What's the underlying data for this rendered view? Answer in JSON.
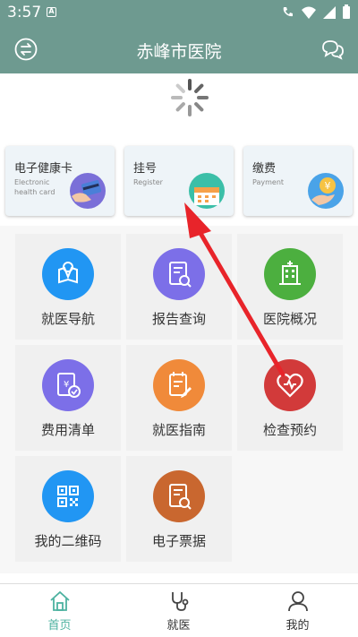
{
  "status_bar": {
    "time": "3:57",
    "a_badge": "A"
  },
  "header": {
    "title": "赤峰市医院",
    "left_icon": "switch-arrows-icon",
    "right_icon": "chat-bubbles-icon",
    "color": "#6e9a90"
  },
  "cards": [
    {
      "cn": "电子健康卡",
      "en": "Electronic health card",
      "icon": "health-card-icon"
    },
    {
      "cn": "挂号",
      "en": "Register",
      "icon": "calendar-icon"
    },
    {
      "cn": "缴费",
      "en": "Payment",
      "icon": "payment-icon"
    }
  ],
  "tiles": [
    {
      "label": "就医导航",
      "icon": "map-navigation-icon",
      "color": "#2196f3"
    },
    {
      "label": "报告查询",
      "icon": "report-search-icon",
      "color": "#7c6fe8"
    },
    {
      "label": "医院概况",
      "icon": "hospital-building-icon",
      "color": "#4caf3f"
    },
    {
      "label": "费用清单",
      "icon": "expense-list-icon",
      "color": "#7c6fe8"
    },
    {
      "label": "就医指南",
      "icon": "guide-icon",
      "color": "#f08a3a"
    },
    {
      "label": "检查预约",
      "icon": "heart-appointment-icon",
      "color": "#d23a3a"
    },
    {
      "label": "我的二维码",
      "icon": "qr-code-icon",
      "color": "#2196f3"
    },
    {
      "label": "电子票据",
      "icon": "e-receipt-icon",
      "color": "#c9672f"
    }
  ],
  "tabbar": {
    "items": [
      {
        "label": "首页",
        "icon": "home-icon",
        "active": true
      },
      {
        "label": "就医",
        "icon": "stethoscope-icon",
        "active": false
      },
      {
        "label": "我的",
        "icon": "user-icon",
        "active": false
      }
    ],
    "active_color": "#4db2a0"
  }
}
